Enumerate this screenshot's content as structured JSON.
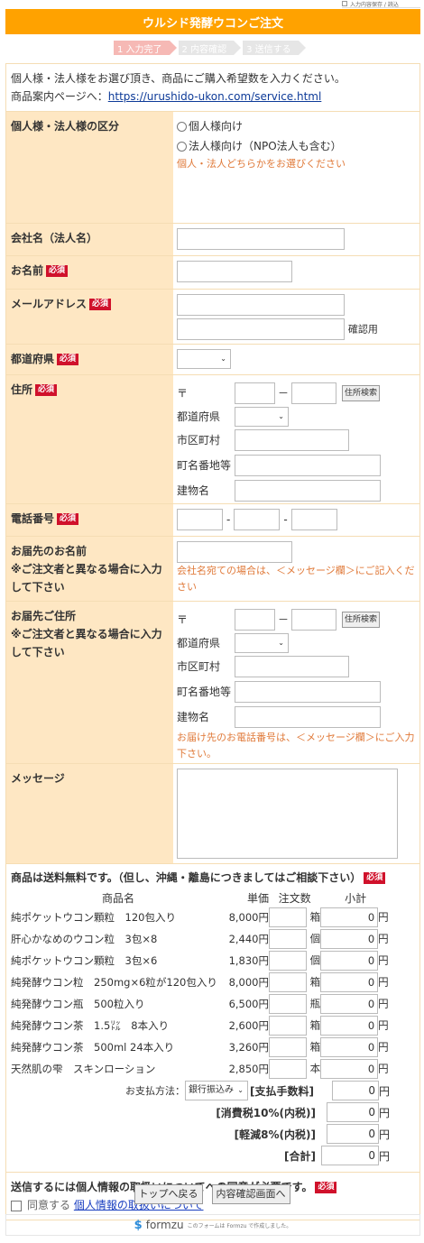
{
  "top_save": "入力内容保存 / 読込",
  "title": "ウルシド発酵ウコンご注文",
  "steps": [
    "1 入力完了",
    "2 内容確認",
    "3 送信する"
  ],
  "intro": {
    "line1": "個人様・法人様をお選び頂き、商品にご購入希望数を入力ください。",
    "line2_prefix": "商品案内ページへ：",
    "link": "https://urushido-ukon.com/service.html"
  },
  "required_label": "必須",
  "fields": {
    "category": {
      "label": "個人様・法人様の区分",
      "options": [
        "個人様向け",
        "法人様向け（NPO法人も含む）"
      ],
      "note": "個人・法人どちらかをお選びください"
    },
    "company": {
      "label": "会社名（法人名）"
    },
    "name": {
      "label": "お名前"
    },
    "email": {
      "label": "メールアドレス",
      "confirm": "確認用"
    },
    "prefecture": {
      "label": "都道府県"
    },
    "address": {
      "label": "住所",
      "postal": "〒",
      "dash": "－",
      "search": "住所検索",
      "pref": "都道府県",
      "city": "市区町村",
      "street": "町名番地等",
      "building": "建物名"
    },
    "phone": {
      "label": "電話番号",
      "dash": "-"
    },
    "ship_name": {
      "label1": "お届先のお名前",
      "label2": "※ご注文者と異なる場合に入力して下さい",
      "note": "会社名宛ての場合は、＜メッセージ欄＞にご記入ください"
    },
    "ship_address": {
      "label1": "お届先ご住所",
      "label2": "※ご注文者と異なる場合に入力して下さい",
      "note": "お届け先のお電話番号は、＜メッセージ欄＞にご入力下さい。"
    },
    "message": {
      "label": "メッセージ"
    }
  },
  "products": {
    "heading": "商品は送料無料です。（但し、沖縄・離島につきましてはご相談下さい）",
    "columns": [
      "商品名",
      "単価",
      "注文数",
      "小計"
    ],
    "currency": "円",
    "items": [
      {
        "name": "純ポケットウコン顆粒　120包入り",
        "price": "8,000円",
        "unit": "箱",
        "subtotal": "0"
      },
      {
        "name": "肝心かなめのウコン粒　3包×8",
        "price": "2,440円",
        "unit": "個",
        "subtotal": "0"
      },
      {
        "name": "純ポケットウコン顆粒　3包×6",
        "price": "1,830円",
        "unit": "個",
        "subtotal": "0"
      },
      {
        "name": "純発酵ウコン粒　250mg×6粒が120包入り",
        "price": "8,000円",
        "unit": "箱",
        "subtotal": "0"
      },
      {
        "name": "純発酵ウコン瓶　500粒入り",
        "price": "6,500円",
        "unit": "瓶",
        "subtotal": "0"
      },
      {
        "name": "純発酵ウコン茶　1.5㍑　8本入り",
        "price": "2,600円",
        "unit": "箱",
        "subtotal": "0"
      },
      {
        "name": "純発酵ウコン茶　500ml 24本入り",
        "price": "3,260円",
        "unit": "箱",
        "subtotal": "0"
      },
      {
        "name": "天然肌の雫　スキンローション",
        "price": "2,850円",
        "unit": "本",
        "subtotal": "0"
      }
    ],
    "payment_label": "お支払方法：",
    "payment_value": "銀行振込み",
    "fee_label": "[支払手数料]",
    "fee_value": "0",
    "tax10_label": "[消費税10%(内税)]",
    "tax10_value": "0",
    "tax8_label": "[軽減8%(内税)]",
    "tax8_value": "0",
    "total_label": "[合計]",
    "total_value": "0"
  },
  "consent": {
    "text": "送信するには個人情報の取扱いについてへの同意が必要です。",
    "agree": "同意する",
    "link": "個人情報の取扱いについて"
  },
  "buttons": {
    "top": "トップへ戻る",
    "confirm": "内容確認画面へ"
  },
  "footer": {
    "brand": "formzu",
    "note": "このフォームは Formzu で作成しました。"
  }
}
